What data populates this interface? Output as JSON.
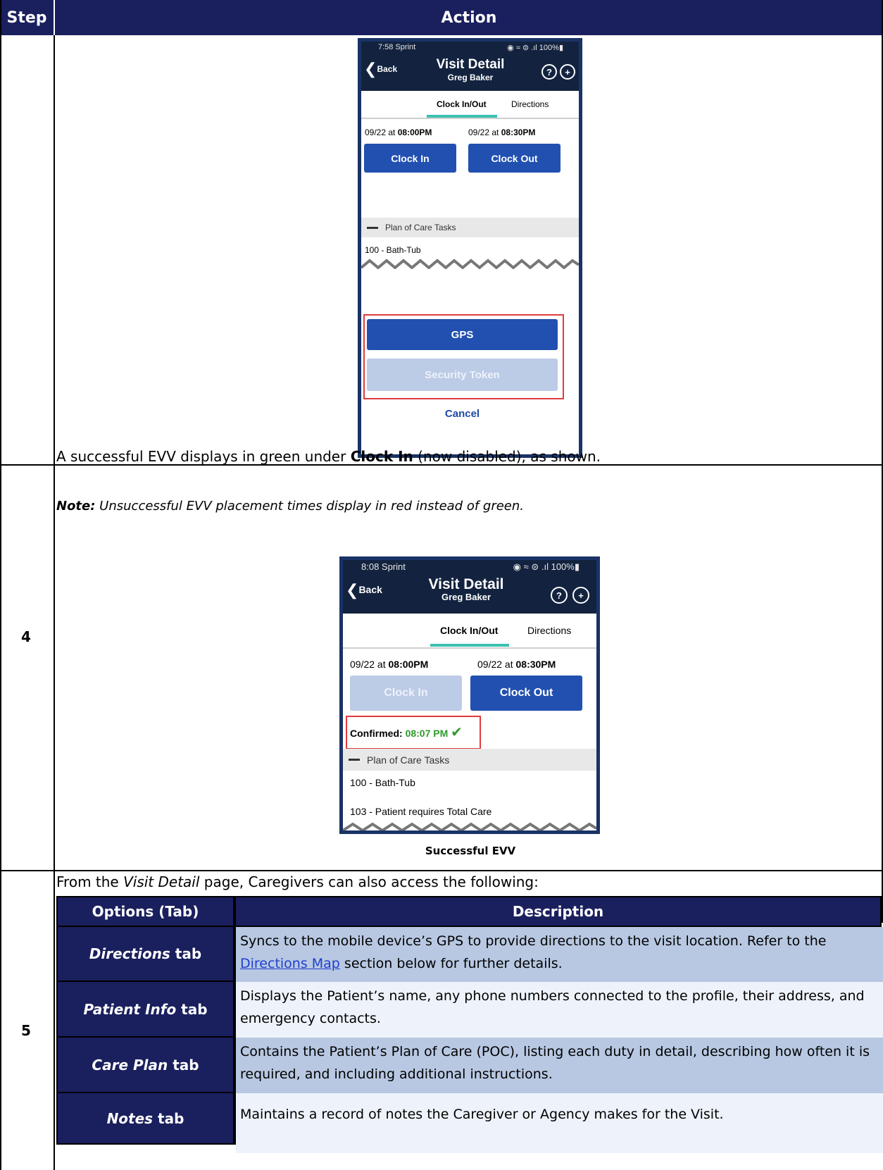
{
  "table_header": {
    "step": "Step",
    "action": "Action"
  },
  "phone1": {
    "status_time": "7:58 Sprint",
    "status_right": "◉ ≈ ⊜ .ıl 100%▮",
    "back": "Back",
    "title": "Visit Detail",
    "subtitle": "Greg Baker",
    "tabs": [
      "Clock In/Out",
      "Directions"
    ],
    "clock_in_time_prefix": "09/22 at ",
    "clock_in_time": "08:00PM",
    "clock_out_time_prefix": "09/22 at ",
    "clock_out_time": "08:30PM",
    "clock_in": "Clock In",
    "clock_out": "Clock Out",
    "section": "Plan of Care Tasks",
    "task1": "100 - Bath-Tub",
    "gps": "GPS",
    "security_token": "Security Token",
    "cancel": "Cancel"
  },
  "step4": {
    "number": "4",
    "text_before": "A successful EVV displays in green under ",
    "text_bold": "Clock In",
    "text_after": " (now disabled), as shown.",
    "note_label": "Note:",
    "note_text": " Unsuccessful EVV placement times display in red instead of green.",
    "caption": "Successful EVV"
  },
  "phone2": {
    "status_time": "8:08 Sprint",
    "status_right": "◉ ≈ ⊜ .ıl 100%▮",
    "back": "Back",
    "title": "Visit Detail",
    "subtitle": "Greg Baker",
    "tabs": [
      "Clock In/Out",
      "Directions"
    ],
    "clock_in_time_prefix": "09/22 at ",
    "clock_in_time": "08:00PM",
    "clock_out_time_prefix": "09/22 at ",
    "clock_out_time": "08:30PM",
    "clock_in": "Clock In",
    "clock_out": "Clock Out",
    "confirmed_label": "Confirmed:",
    "confirmed_time": "08:07 PM",
    "section": "Plan of Care Tasks",
    "task1": "100 - Bath-Tub",
    "task2": "103 - Patient requires Total Care",
    "colors": {
      "confirmed": "#2e9a2e"
    }
  },
  "step5": {
    "number": "5",
    "intro_before": "From the ",
    "intro_italic": "Visit Detail",
    "intro_after": " page, Caregivers can also access the following:",
    "table_headers": {
      "options": "Options (Tab)",
      "description": "Description"
    },
    "rows": [
      {
        "tab_italic": "Directions",
        "tab_suffix": " tab",
        "desc_before": "Syncs to the mobile device’s GPS to provide directions to the visit location. Refer to the ",
        "desc_link": "Directions Map",
        "desc_after": " section below for further details."
      },
      {
        "tab_italic": "Patient Info",
        "tab_suffix": " tab",
        "desc": "Displays the Patient’s name, any phone numbers connected to the profile, their address, and emergency contacts."
      },
      {
        "tab_italic": "Care Plan",
        "tab_suffix": " tab",
        "desc": "Contains the Patient’s Plan of Care (POC), listing each duty in detail, describing how often it is required, and including additional instructions."
      },
      {
        "tab_italic": "Notes",
        "tab_suffix": " tab",
        "desc": "Maintains a record of notes the Caregiver or Agency makes for the Visit."
      }
    ]
  },
  "colors": {
    "header_bg": "#1a1f5e",
    "button_blue": "#2150b0",
    "tab_accent": "#3cc0b0",
    "highlight_red": "#e03c3c"
  }
}
